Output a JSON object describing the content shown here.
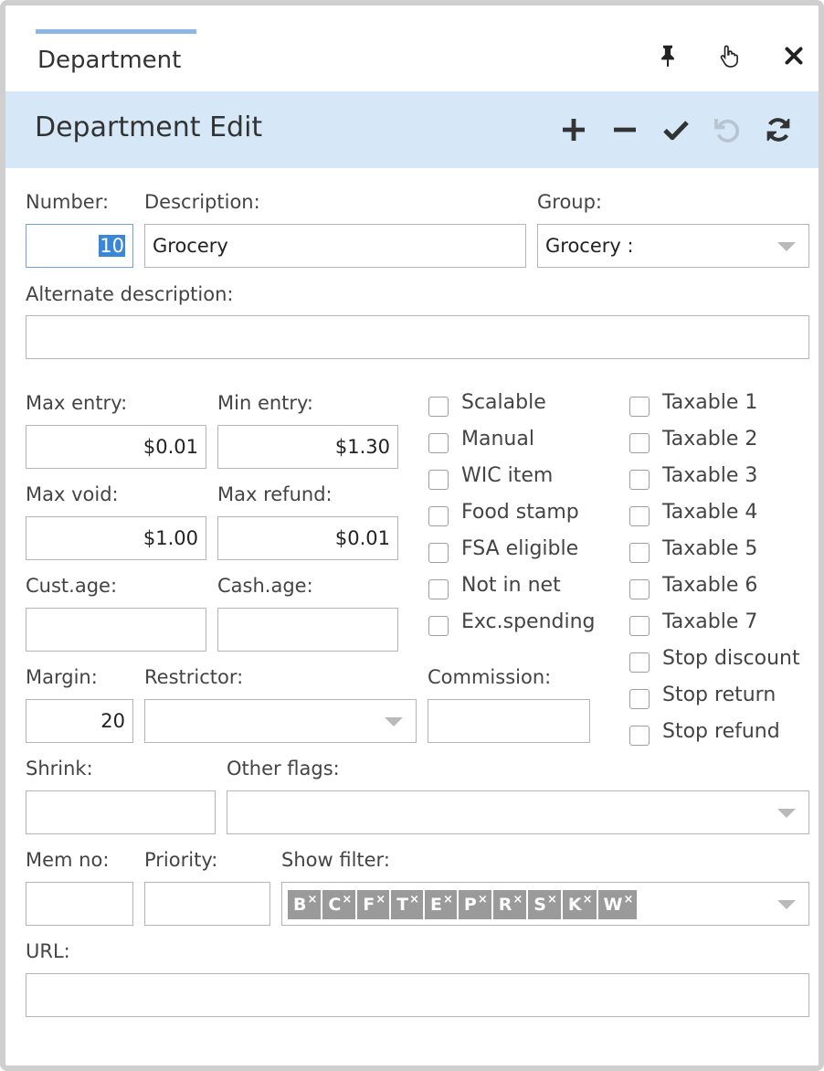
{
  "window": {
    "tab_title": "Department",
    "tab_icons": [
      "pin-icon",
      "pointer-hand-icon",
      "close-icon"
    ]
  },
  "header": {
    "title": "Department Edit",
    "actions": [
      "add-icon",
      "remove-icon",
      "confirm-check-icon",
      "undo-icon",
      "refresh-icon"
    ]
  },
  "form": {
    "number": {
      "label": "Number:",
      "value": "10"
    },
    "description": {
      "label": "Description:",
      "value": "Grocery"
    },
    "group": {
      "label": "Group:",
      "value": "Grocery :"
    },
    "alternate_description": {
      "label": "Alternate description:",
      "value": ""
    },
    "max_entry": {
      "label": "Max entry:",
      "value": "$0.01"
    },
    "min_entry": {
      "label": "Min entry:",
      "value": "$1.30"
    },
    "max_void": {
      "label": "Max void:",
      "value": "$1.00"
    },
    "max_refund": {
      "label": "Max refund:",
      "value": "$0.01"
    },
    "cust_age": {
      "label": "Cust.age:",
      "value": ""
    },
    "cash_age": {
      "label": "Cash.age:",
      "value": ""
    },
    "margin": {
      "label": "Margin:",
      "value": "20"
    },
    "restrictor": {
      "label": "Restrictor:",
      "value": ""
    },
    "commission": {
      "label": "Commission:",
      "value": ""
    },
    "shrink": {
      "label": "Shrink:",
      "value": ""
    },
    "other_flags": {
      "label": "Other flags:",
      "value": ""
    },
    "mem_no": {
      "label": "Mem no:",
      "value": ""
    },
    "priority": {
      "label": "Priority:",
      "value": ""
    },
    "show_filter": {
      "label": "Show filter:",
      "tags": [
        "B",
        "C",
        "F",
        "T",
        "E",
        "P",
        "R",
        "S",
        "K",
        "W"
      ],
      "tag_remove": "×"
    },
    "url": {
      "label": "URL:",
      "value": ""
    }
  },
  "checkboxes_left": [
    {
      "label": "Scalable",
      "checked": false
    },
    {
      "label": "Manual",
      "checked": false
    },
    {
      "label": "WIC item",
      "checked": false
    },
    {
      "label": "Food stamp",
      "checked": false
    },
    {
      "label": "FSA eligible",
      "checked": false
    },
    {
      "label": "Not in net",
      "checked": false
    },
    {
      "label": "Exc.spending",
      "checked": false
    }
  ],
  "checkboxes_right": [
    {
      "label": "Taxable 1",
      "checked": false
    },
    {
      "label": "Taxable 2",
      "checked": false
    },
    {
      "label": "Taxable 3",
      "checked": false
    },
    {
      "label": "Taxable 4",
      "checked": false
    },
    {
      "label": "Taxable 5",
      "checked": false
    },
    {
      "label": "Taxable 6",
      "checked": false
    },
    {
      "label": "Taxable 7",
      "checked": false
    },
    {
      "label": "Stop discount",
      "checked": false
    },
    {
      "label": "Stop return",
      "checked": false
    },
    {
      "label": "Stop refund",
      "checked": false
    }
  ],
  "colors": {
    "header_bg": "#d6e8f8",
    "tab_accent": "#8db7e6",
    "selection": "#3a86d8",
    "tag_bg": "#9a9a9a"
  }
}
